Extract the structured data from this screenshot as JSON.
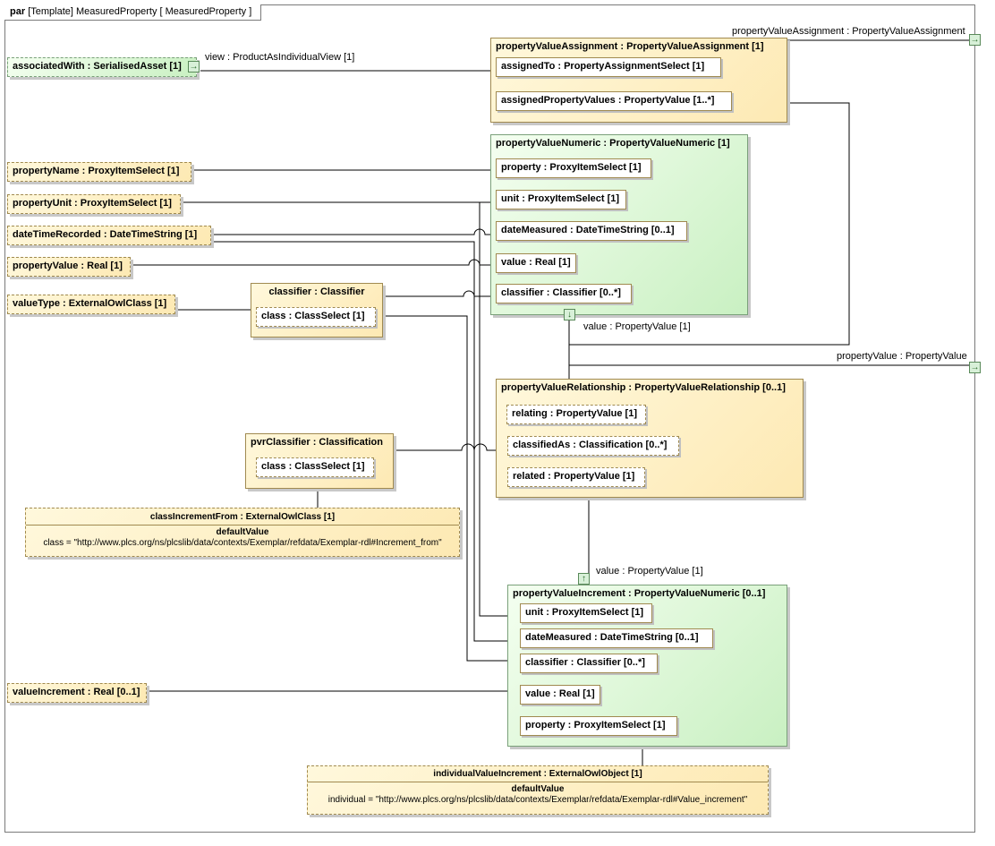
{
  "frame": {
    "kind": "par",
    "name": "[Template] MeasuredProperty [ MeasuredProperty ]"
  },
  "ports": {
    "associated_with": "associatedWith : SerialisedAsset [1]",
    "view_label": "view : ProductAsIndividualView [1]",
    "right_pva_label": "propertyValueAssignment : PropertyValueAssignment",
    "right_pv_label": "propertyValue : PropertyValue",
    "pvn_value_label": "value : PropertyValue [1]",
    "pvi_value_label": "value : PropertyValue [1]"
  },
  "inputs": {
    "property_name": "propertyName : ProxyItemSelect [1]",
    "property_unit": "propertyUnit : ProxyItemSelect [1]",
    "date_time_recorded": "dateTimeRecorded : DateTimeString [1]",
    "property_value": "propertyValue : Real [1]",
    "value_type": "valueType : ExternalOwlClass [1]",
    "value_increment": "valueIncrement : Real [0..1]"
  },
  "pva": {
    "title": "propertyValueAssignment : PropertyValueAssignment [1]",
    "assigned_to": "assignedTo : PropertyAssignmentSelect [1]",
    "assigned_values": "assignedPropertyValues : PropertyValue [1..*]"
  },
  "pvn": {
    "title": "propertyValueNumeric : PropertyValueNumeric [1]",
    "property": "property : ProxyItemSelect [1]",
    "unit": "unit : ProxyItemSelect [1]",
    "date_measured": "dateMeasured : DateTimeString [0..1]",
    "value": "value : Real [1]",
    "classifier": "classifier : Classifier [0..*]"
  },
  "classifier": {
    "title": "classifier : Classifier",
    "class": "class : ClassSelect [1]"
  },
  "pvr": {
    "title": "propertyValueRelationship : PropertyValueRelationship [0..1]",
    "relating": "relating : PropertyValue [1]",
    "classified_as": "classifiedAs : Classification [0..*]",
    "related": "related : PropertyValue [1]"
  },
  "pvr_classifier": {
    "title": "pvrClassifier : Classification",
    "class": "class : ClassSelect [1]"
  },
  "class_increment_from": {
    "title": "classIncrementFrom : ExternalOwlClass [1]",
    "default_label": "defaultValue",
    "default_value": "class = \"http://www.plcs.org/ns/plcslib/data/contexts/Exemplar/refdata/Exemplar-rdl#Increment_from\""
  },
  "pvi": {
    "title": "propertyValueIncrement : PropertyValueNumeric [0..1]",
    "unit": "unit : ProxyItemSelect [1]",
    "date_measured": "dateMeasured : DateTimeString [0..1]",
    "classifier": "classifier : Classifier [0..*]",
    "value": "value : Real [1]",
    "property": "property : ProxyItemSelect [1]"
  },
  "individual_value_increment": {
    "title": "individualValueIncrement : ExternalOwlObject [1]",
    "default_label": "defaultValue",
    "default_value": "individual = \"http://www.plcs.org/ns/plcslib/data/contexts/Exemplar/refdata/Exemplar-rdl#Value_increment\""
  },
  "colors": {
    "box_fill": "#fde9b3",
    "green_fill": "#c9f0c2",
    "border": "#a08a50",
    "wire": "#000000"
  }
}
